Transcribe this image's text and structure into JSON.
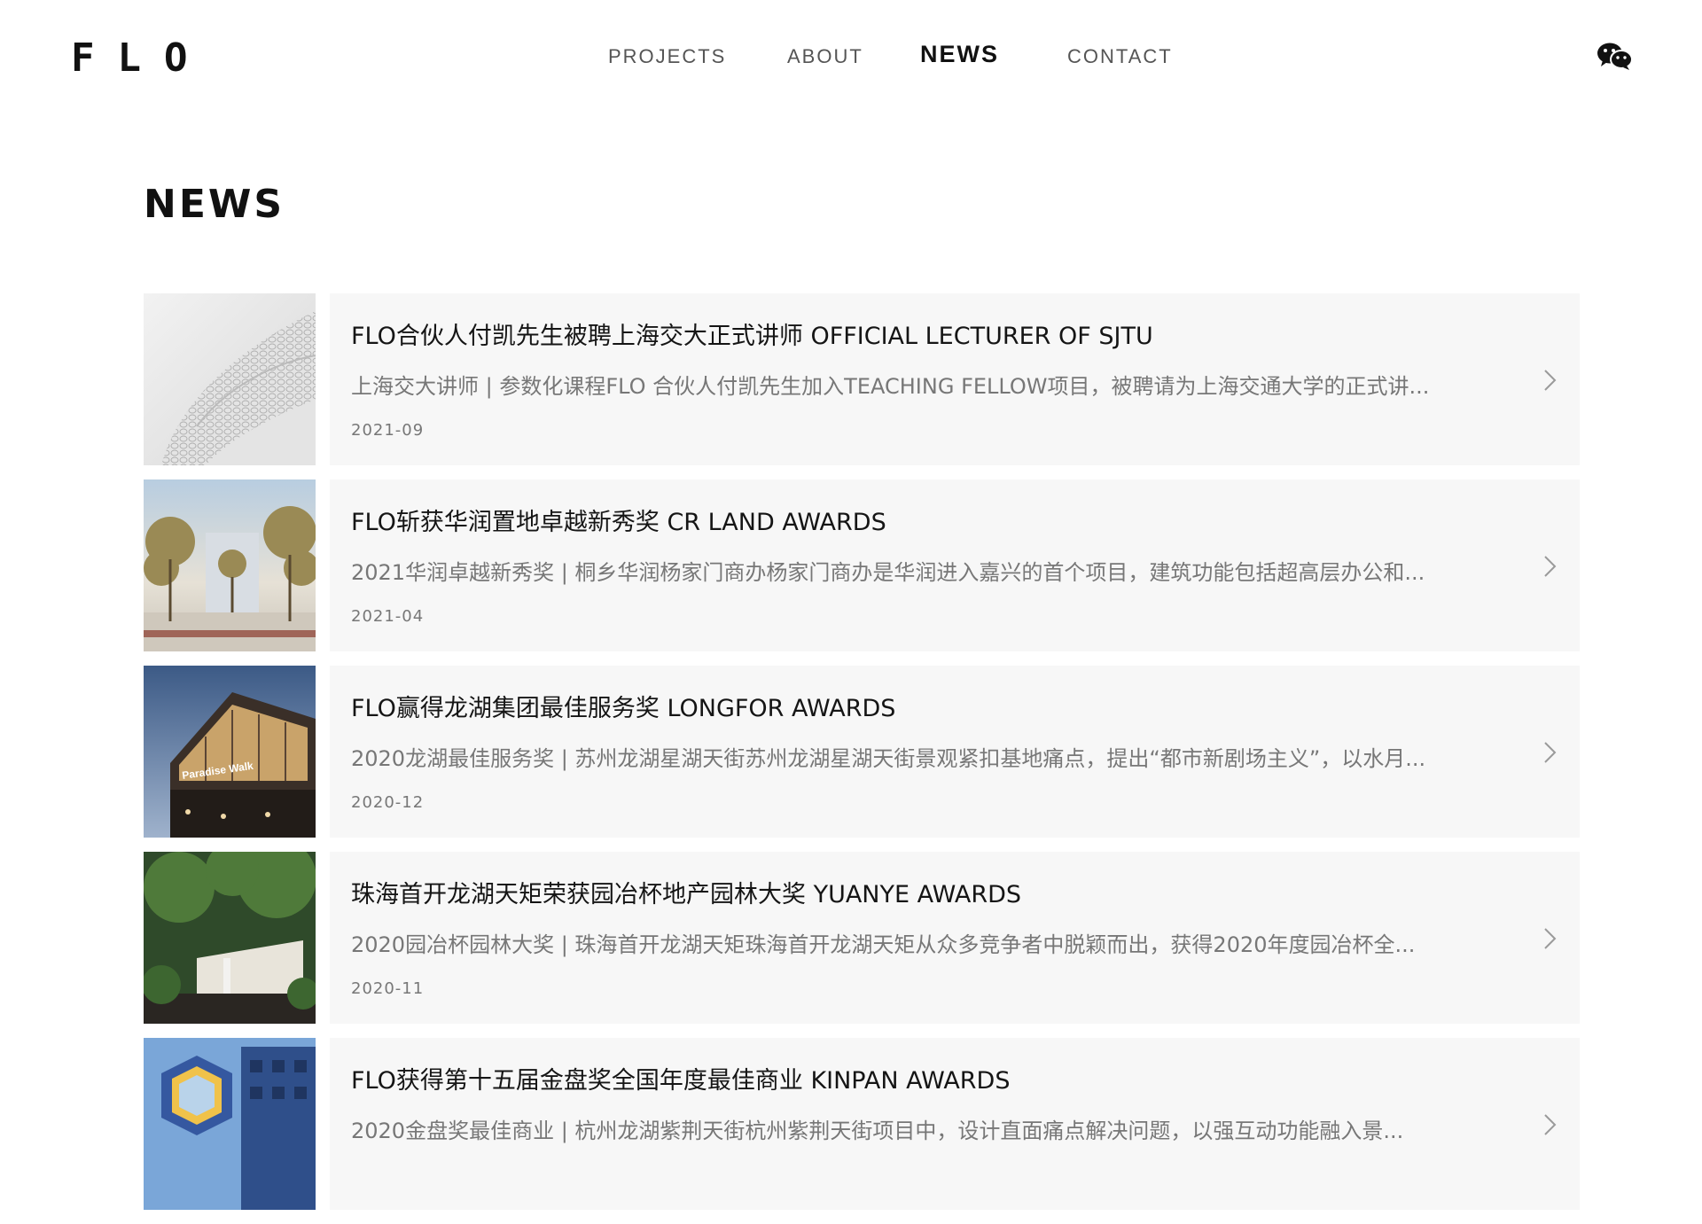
{
  "header": {
    "logo": "FLO",
    "nav": [
      {
        "label": "PROJECTS"
      },
      {
        "label": "ABOUT"
      },
      {
        "label": "NEWS"
      },
      {
        "label": "CONTACT"
      }
    ],
    "wechat_icon": "wechat-icon"
  },
  "page": {
    "title": "NEWS"
  },
  "news": [
    {
      "title": "FLO合伙人付凯先生被聘上海交大正式讲师 OFFICIAL LECTURER OF SJTU",
      "description": "上海交大讲师 | 参数化课程FLO 合伙人付凯先生加入TEACHING FELLOW项目，被聘请为上海交通大学的正式讲...",
      "date": "2021-09"
    },
    {
      "title": "FLO斩获华润置地卓越新秀奖 CR LAND AWARDS",
      "description": "2021华润卓越新秀奖 | 桐乡华润杨家门商办杨家门商办是华润进入嘉兴的首个项目，建筑功能包括超高层办公和...",
      "date": "2021-04"
    },
    {
      "title": "FLO赢得龙湖集团最佳服务奖 LONGFOR AWARDS",
      "description": "2020龙湖最佳服务奖 | 苏州龙湖星湖天街苏州龙湖星湖天街景观紧扣基地痛点，提出“都市新剧场主义”，以水月...",
      "date": "2020-12",
      "thumb_sign": "Paradise Walk"
    },
    {
      "title": "珠海首开龙湖天矩荣获园冶杯地产园林大奖 YUANYE AWARDS",
      "description": "2020园冶杯园林大奖 | 珠海首开龙湖天矩珠海首开龙湖天矩从众多竞争者中脱颖而出，获得2020年度园冶杯全...",
      "date": "2020-11"
    },
    {
      "title": "FLO获得第十五届金盘奖全国年度最佳商业 KINPAN AWARDS",
      "description": "2020金盘奖最佳商业 | 杭州龙湖紫荆天街杭州紫荆天街项目中，设计直面痛点解决问题，以强互动功能融入景...",
      "date": ""
    }
  ]
}
